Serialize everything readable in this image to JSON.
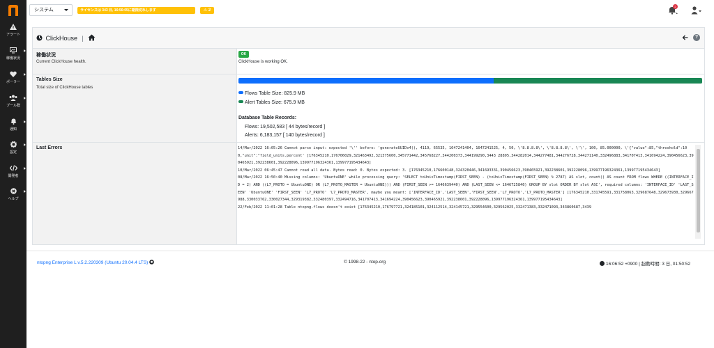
{
  "sidebar": {
    "items": [
      {
        "label": "アラート",
        "icon": "warning-icon"
      },
      {
        "label": "稼働状況",
        "icon": "monitor-icon"
      },
      {
        "label": "ポーラー",
        "icon": "heartbeat-icon"
      },
      {
        "label": "プール群",
        "icon": "users-icon"
      },
      {
        "label": "通知",
        "icon": "bell-icon"
      },
      {
        "label": "設定",
        "icon": "gear-icon"
      },
      {
        "label": "開発者",
        "icon": "code-icon"
      },
      {
        "label": "ヘルプ",
        "icon": "help-icon"
      }
    ]
  },
  "topbar": {
    "select_value": "システム",
    "license_text": "ライセンスは 343 日, 16:56:05に期限切れします",
    "warning_count": "2",
    "notification_count": "2"
  },
  "page": {
    "title": "ClickHouse"
  },
  "rows": {
    "status": {
      "title": "稼働状況",
      "subtitle": "Current ClickHouse health.",
      "badge": "OK",
      "message": "ClickHouse is working OK."
    },
    "tables": {
      "title": "Tables Size",
      "subtitle": "Total size of ClickHouse tables",
      "flows_label": "Flows Table Size: 825.9 MB",
      "alerts_label": "Alert Tables Size: 675.9 MB",
      "flows_fraction": 0.55,
      "alerts_fraction": 0.45,
      "records_title": "Database Table Records:",
      "flows_records": "Flows: 19,502,583 [ 44 bytes/record ]",
      "alerts_records": "Alerts: 6,183,157 [ 140 bytes/record ]"
    },
    "errors": {
      "title": "Last Errors",
      "log": "14/Mar/2022 16:05:26 Cannot parse input: expected '\\'' before: 'generateUUIDv4(), 4119, 65535, 1647241404, 1647241525, 4, 50, \\'8.8.8.8\\', \\'8.8.8.8\\', \\'\\', 100, 85.000000, \\'{\"value\":85,\"threshold\":100,\"unit\":\"field_units.percent' [176345210,176706029,321463492,321375600,345771442,345768227,344200373,344199290,3443 28895,344282014,344277481,344276728,344271140,332496883,341707413,341694224,390456623,390465921,392238601,392228096,139977196324361,139977195434643]\n10/Mar/2022 06:45:47 Cannot read all data. Bytes read: 0. Bytes expected: 3. [176345210,176600148,324320446,341693331,390456623,390465921,392238601,392228096,139977196324361,139977195434643]\n08/Mar/2022 16:50:40 Missing columns: 'UbuntuONE' while processing query: 'SELECT toUnixTimestamp(FIRST_SEEN) - (toUnixTimestamp(FIRST_SEEN) % 2787) AS slot, count() AS count FROM flows WHERE ((INTERFACE_ID = 2) AND ((L7_PROTO = UbuntuONE) OR (L7_PROTO_MASTER = UbuntuONE))) AND (FIRST_SEEN >= 1646639440) AND (LAST_SEEN <= 1646725840) GROUP BY slot ORDER BY slot ASC', required columns: 'INTERFACE_ID' 'LAST_SEEN' 'UbuntuONE' 'FIRST_SEEN' 'L7_PROTO' 'L7_PROTO_MASTER', maybe you meant: ['INTERFACE_ID','LAST_SEEN','FIRST_SEEN','L7_PROTO','L7_PROTO_MASTER'] [176345210,331745591,331758063,329687648,329673930,329667988,330033762,330027344,329319382,332480397,332494716,341707413,341694224,390456623,390465921,392238601,392228096,139977196324361,139977195434643]\n22/Feb/2022 11:01:28 Table ntopng.flows doesn't exist [176345210,176797721,324185101,324112514,324145721,329554600,329562025,332471383,332471093,343860687,3439"
    }
  },
  "footer": {
    "version": "ntopng Enterprise L v.5.2.220309 (Ubuntu 20.04.4 LTS)",
    "copyright": "© 1998-22 - ntop.org",
    "time": "16:06:52 +0900 | 起動時間: 3 日, 01:50:52"
  },
  "colors": {
    "flows": "#0d6efd",
    "alerts": "#198754",
    "ok": "#28a745",
    "warning": "#ffc107",
    "logo": "#f57c00"
  }
}
